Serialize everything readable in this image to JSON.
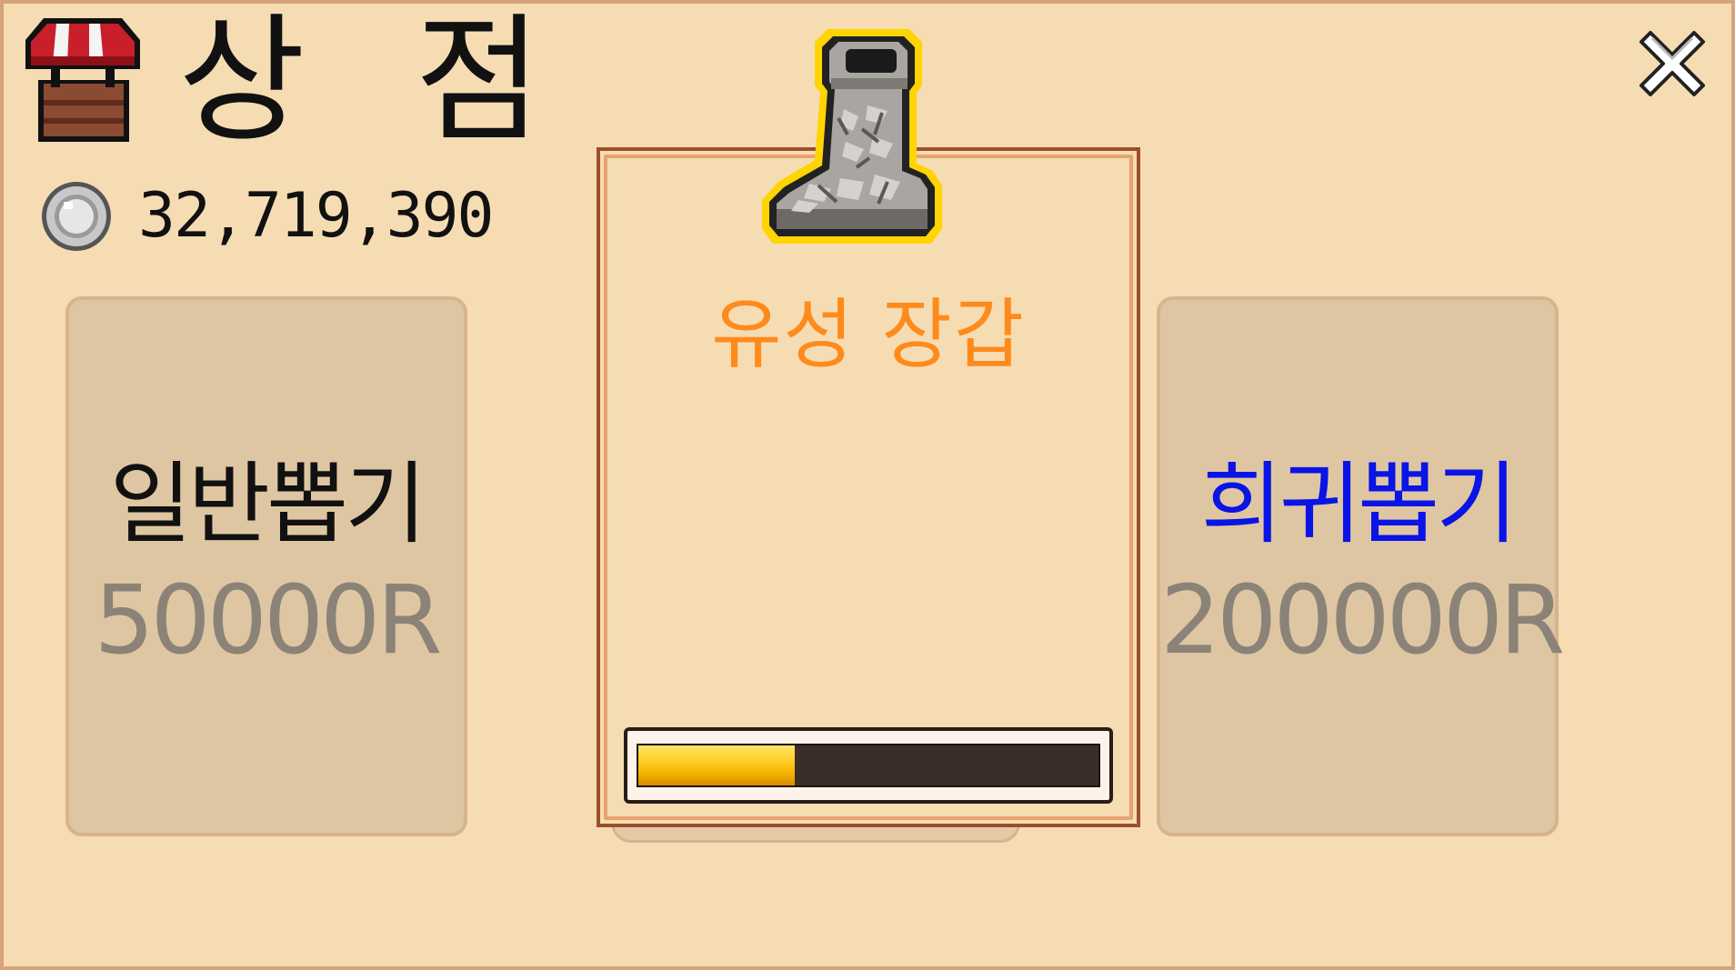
{
  "header": {
    "title": "상 점",
    "shop_icon": "shop-awning-icon",
    "close_icon": "close-x-icon"
  },
  "currency": {
    "icon": "silver-coin-icon",
    "amount": "32,719,390"
  },
  "gacha": {
    "normal": {
      "label": "일반뽑기",
      "price": "50000R",
      "label_color": "#111111"
    },
    "rare": {
      "label": "희귀뽑기",
      "price": "200000R",
      "label_color": "#0a14e6"
    }
  },
  "reward": {
    "item_icon": "stone-boot-icon",
    "item_name": "유성 장갑",
    "item_name_color": "#ff8a1c",
    "progress": 0.34
  },
  "colors": {
    "background": "#f6dcb3",
    "card": "#dfc6a2",
    "price_text": "#8b8378",
    "progress_fill": "#ffd12c"
  }
}
